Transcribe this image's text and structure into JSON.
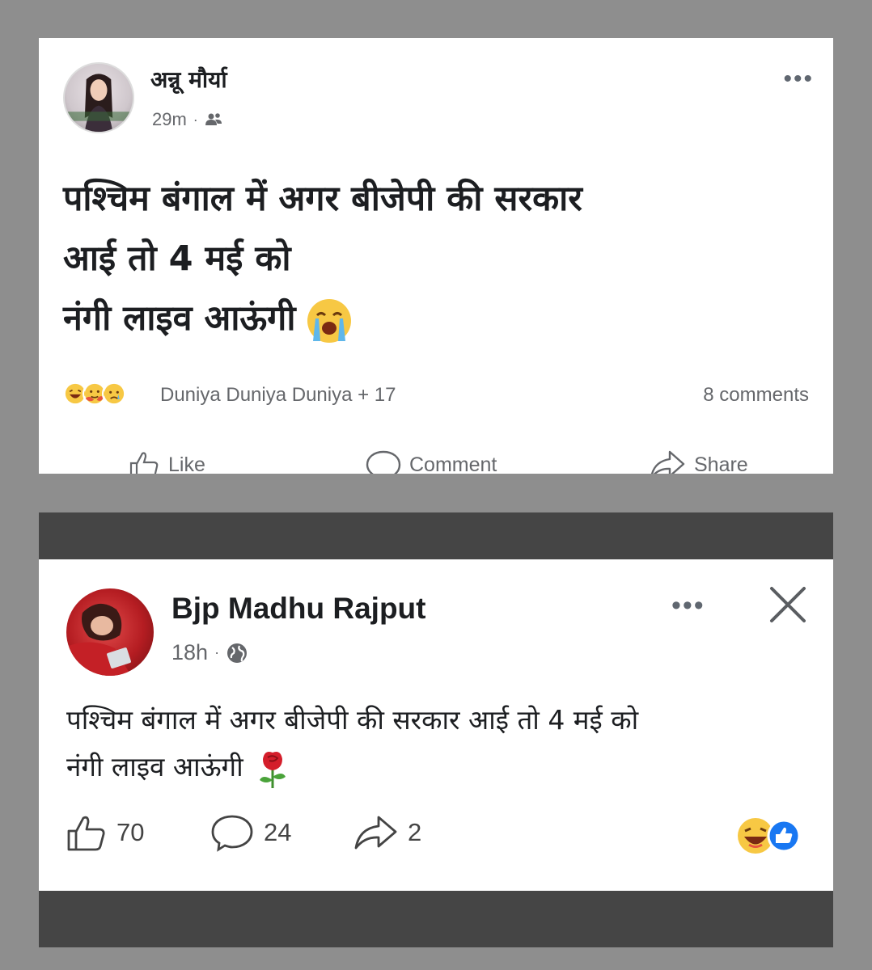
{
  "post1": {
    "author": "अन्नू मौर्या",
    "time": "29m",
    "audience_icon": "friends-icon",
    "more_label": "•••",
    "text_lines": [
      "पश्चिम बंगाल में अगर बीजेपी की सरकार",
      "आई तो 4 मई को",
      "नंगी लाइव आऊंगी"
    ],
    "text_emoji": "crying-face",
    "reactions": [
      "laughing",
      "hugging",
      "sad"
    ],
    "reaction_names": "Duniya Duniya Duniya + 17",
    "comments": "8 comments",
    "actions": {
      "like": "Like",
      "comment": "Comment",
      "share": "Share"
    }
  },
  "post2": {
    "author": "Bjp Madhu Rajput",
    "time": "18h",
    "audience_icon": "globe-icon",
    "more_label": "•••",
    "text_lines": [
      "पश्चिम बंगाल में अगर बीजेपी की सरकार आई तो 4 मई को",
      "नंगी लाइव आऊंगी"
    ],
    "text_emoji": "rose",
    "likes": "70",
    "comments": "24",
    "shares": "2",
    "reactions": [
      "laughing",
      "like"
    ]
  },
  "colors": {
    "background": "#8e8e8e",
    "card": "#ffffff",
    "band": "#454545",
    "text": "#1c1e21",
    "secondary": "#65676b",
    "like_blue": "#1877f2"
  }
}
